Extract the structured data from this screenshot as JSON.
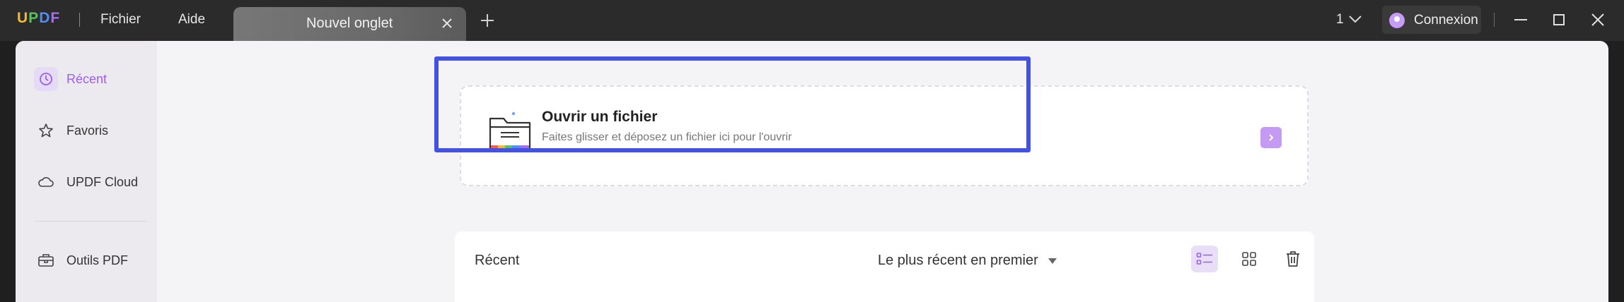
{
  "app": {
    "logo": [
      "U",
      "P",
      "D",
      "F"
    ],
    "menu": {
      "file": "Fichier",
      "help": "Aide"
    },
    "tab": {
      "title": "Nouvel onglet"
    },
    "page_indicator": "1",
    "login_label": "Connexion"
  },
  "sidebar": {
    "items": [
      {
        "label": "Récent",
        "icon": "clock-icon",
        "active": true
      },
      {
        "label": "Favoris",
        "icon": "star-icon",
        "active": false
      },
      {
        "label": "UPDF Cloud",
        "icon": "cloud-icon",
        "active": false
      },
      {
        "label": "Outils PDF",
        "icon": "toolbox-icon",
        "active": false
      }
    ]
  },
  "open_file": {
    "title": "Ouvrir un fichier",
    "subtitle": "Faites glisser et déposez un fichier ici pour l'ouvrir"
  },
  "recent": {
    "title": "Récent",
    "sort_value": "Le plus récent en premier"
  },
  "colors": {
    "accent": "#9b5ff0",
    "highlight": "#4352e3",
    "titlebar": "#2b2b2b"
  }
}
